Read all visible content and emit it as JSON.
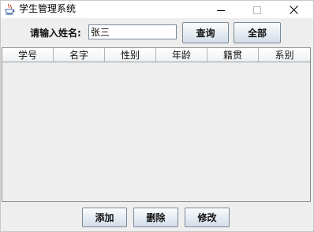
{
  "window": {
    "title": "学生管理系统",
    "app_icon": "java-cup-icon"
  },
  "search": {
    "label": "请输入姓名:",
    "value": "张三",
    "query_button": "查询",
    "all_button": "全部"
  },
  "table": {
    "columns": [
      "学号",
      "名字",
      "性别",
      "年龄",
      "籍贯",
      "系别"
    ],
    "rows": []
  },
  "actions": {
    "add": "添加",
    "delete": "删除",
    "edit": "修改"
  }
}
